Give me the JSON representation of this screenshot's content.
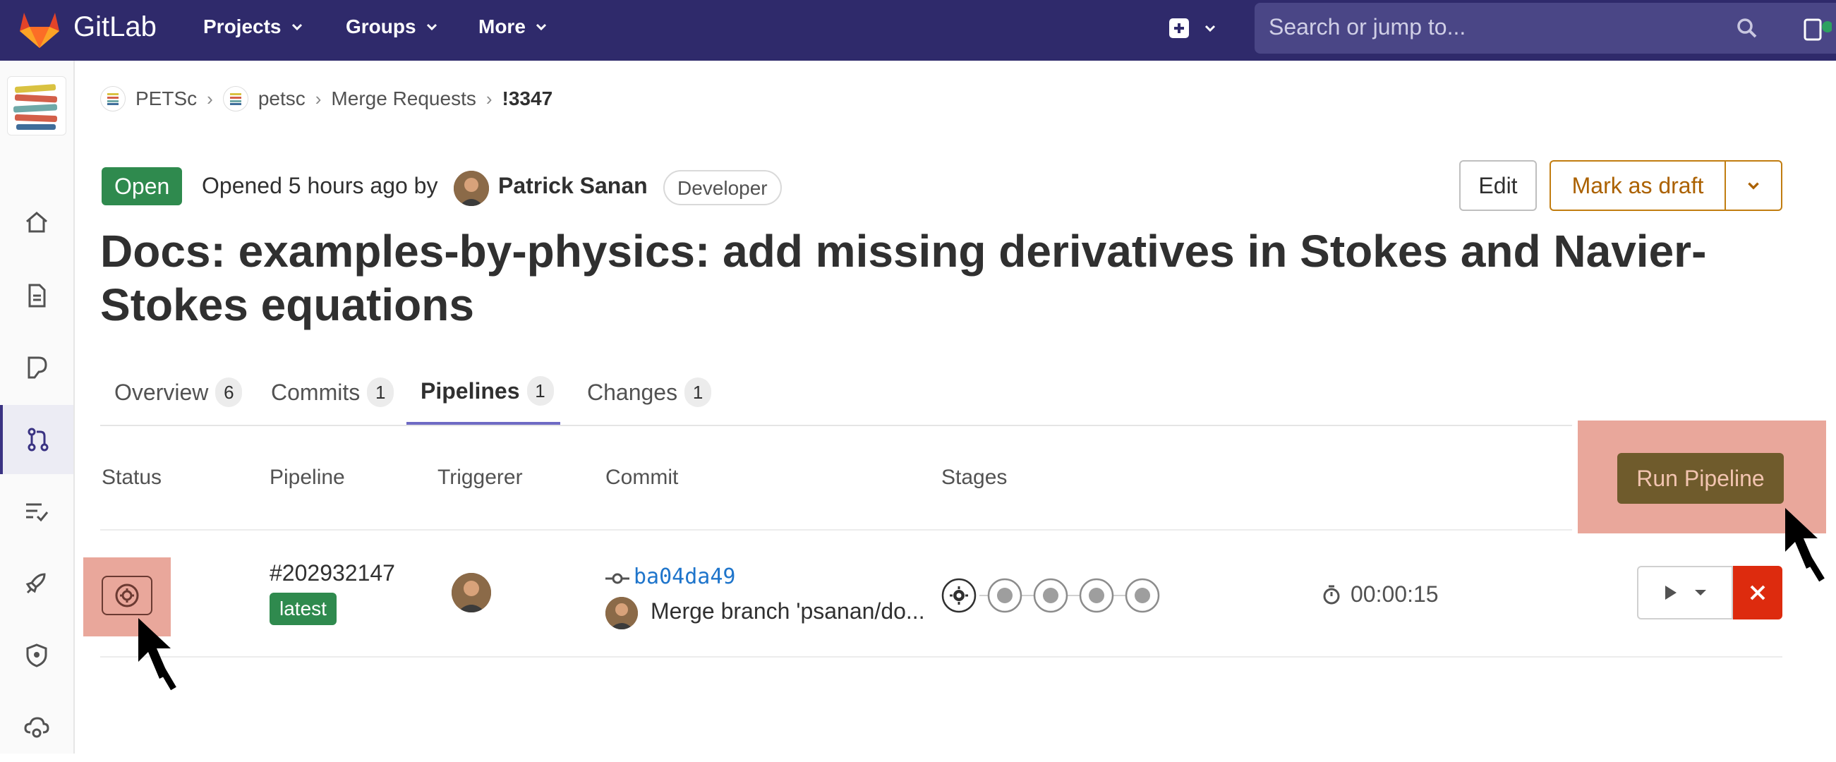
{
  "nav": {
    "brand": "GitLab",
    "links": [
      "Projects",
      "Groups",
      "More"
    ],
    "search_placeholder": "Search or jump to..."
  },
  "breadcrumb": {
    "items": [
      "PETSc",
      "petsc",
      "Merge Requests"
    ],
    "current": "!3347"
  },
  "mr": {
    "status": "Open",
    "opened_text": "Opened 5 hours ago by",
    "author": "Patrick Sanan",
    "role": "Developer",
    "title": "Docs: examples-by-physics: add missing derivatives in Stokes and Navier-Stokes equations",
    "edit_label": "Edit",
    "draft_label": "Mark as draft"
  },
  "tabs": [
    {
      "label": "Overview",
      "count": "6"
    },
    {
      "label": "Commits",
      "count": "1"
    },
    {
      "label": "Pipelines",
      "count": "1"
    },
    {
      "label": "Changes",
      "count": "1"
    }
  ],
  "table": {
    "headers": [
      "Status",
      "Pipeline",
      "Triggerer",
      "Commit",
      "Stages"
    ],
    "run_pipeline_label": "Run Pipeline",
    "row": {
      "pipeline_id": "#202932147",
      "badge": "latest",
      "commit_sha": "ba04da49",
      "commit_message": "Merge branch 'psanan/do...",
      "duration": "00:00:15"
    }
  },
  "colors": {
    "navbar": "#2f2a6b",
    "open_green": "#2f8a4e",
    "draft_orange": "#ab6100",
    "run_button": "#6f5b2c",
    "highlight": "#e9a79b",
    "cancel_red": "#dd2b0e",
    "link_blue": "#1f75cb"
  }
}
